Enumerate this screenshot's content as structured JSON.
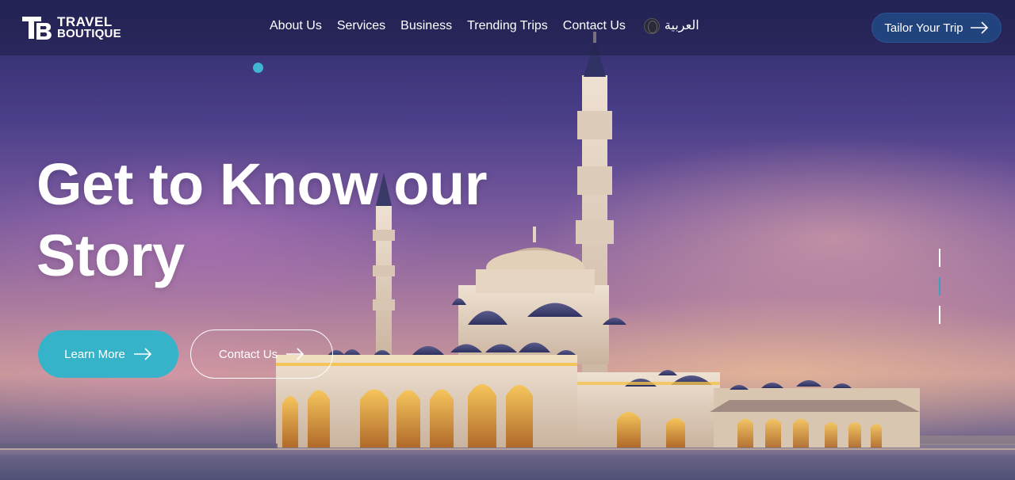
{
  "brand": {
    "line1": "TRAVEL",
    "line2": "BOUTIQUE"
  },
  "nav": {
    "items": [
      {
        "label": "About Us"
      },
      {
        "label": "Services"
      },
      {
        "label": "Business"
      },
      {
        "label": "Trending Trips"
      },
      {
        "label": "Contact Us"
      }
    ],
    "language_label": "العربية",
    "cta_label": "Tailor Your Trip"
  },
  "hero": {
    "title_line1": "Get to Know our",
    "title_line2": "Story",
    "primary_button": "Learn More",
    "secondary_button": "Contact Us"
  },
  "slider": {
    "total_slides": 3,
    "active_slide": 2
  },
  "colors": {
    "accent": "#37b3c9",
    "cta_bg": "#21437e",
    "header_overlay": "rgba(30,30,70,0.55)"
  },
  "icons": {
    "language": "globe-icon",
    "cta": "arrow-right-icon"
  }
}
